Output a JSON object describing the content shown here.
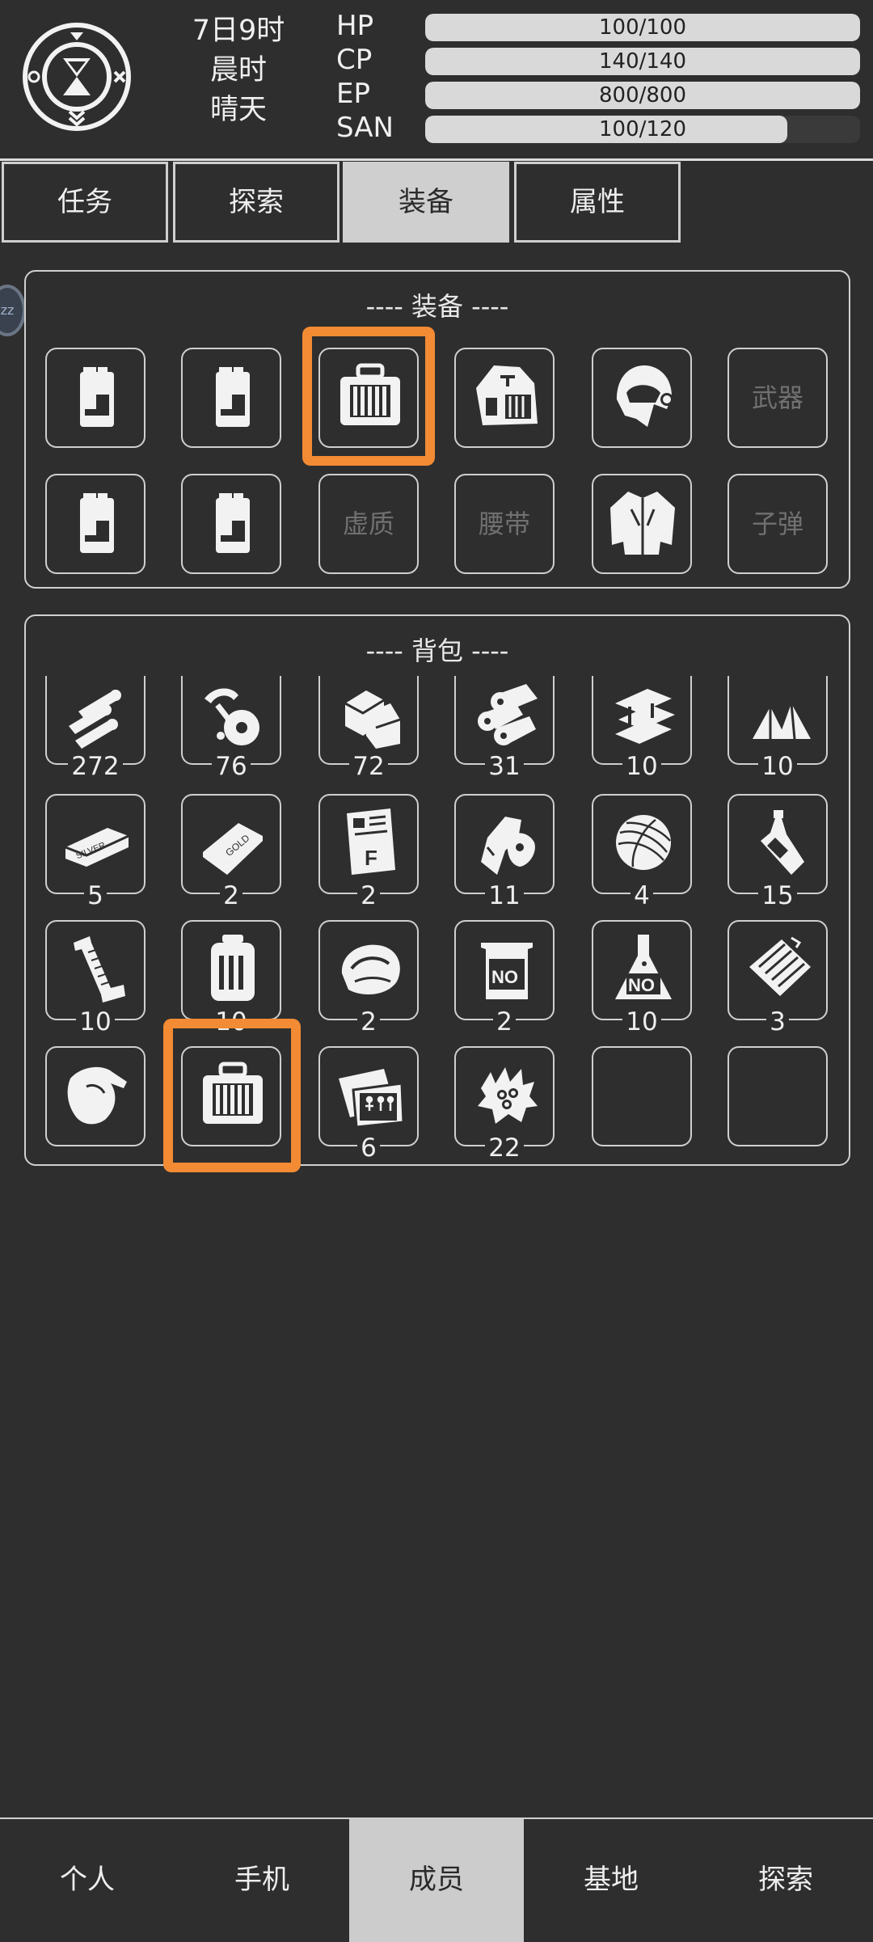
{
  "header": {
    "date": "7日9时",
    "period": "晨时",
    "weather": "晴天",
    "stats": [
      {
        "label": "HP",
        "value": "100/100",
        "fraction": 1.0
      },
      {
        "label": "CP",
        "value": "140/140",
        "fraction": 1.0
      },
      {
        "label": "EP",
        "value": "800/800",
        "fraction": 1.0
      },
      {
        "label": "SAN",
        "value": "100/120",
        "fraction": 0.833
      }
    ]
  },
  "tabs": [
    "任务",
    "探索",
    "装备",
    "属性"
  ],
  "active_tab": "装备",
  "sleep_badge": "zz",
  "equipment": {
    "title": "---- 装备 ----",
    "slots": [
      {
        "icon": "battery-icon"
      },
      {
        "icon": "battery-icon"
      },
      {
        "icon": "toolbox-icon",
        "highlighted": true
      },
      {
        "icon": "backpack-icon"
      },
      {
        "icon": "helmet-icon"
      },
      {
        "label": "武器"
      },
      {
        "icon": "battery-icon"
      },
      {
        "icon": "battery-icon"
      },
      {
        "label": "虚质"
      },
      {
        "label": "腰带"
      },
      {
        "icon": "jacket-icon"
      },
      {
        "label": "子弹"
      }
    ]
  },
  "backpack": {
    "title": "---- 背包 ----",
    "items": [
      {
        "icon": "bullets-icon",
        "count": "272"
      },
      {
        "icon": "mechanical-parts-icon",
        "count": "76"
      },
      {
        "icon": "scrap-metal-icon",
        "count": "72"
      },
      {
        "icon": "pipes-icon",
        "count": "31"
      },
      {
        "icon": "steel-beams-icon",
        "count": "10"
      },
      {
        "icon": "crystals-icon",
        "count": "10"
      },
      {
        "icon": "silver-bar-icon",
        "label": "SILVER",
        "count": "5"
      },
      {
        "icon": "gold-bar-icon",
        "label": "GOLD",
        "count": "2"
      },
      {
        "icon": "document-icon",
        "count": "2"
      },
      {
        "icon": "meat-icon",
        "count": "11"
      },
      {
        "icon": "yarn-ball-icon",
        "count": "4"
      },
      {
        "icon": "bottle-icon",
        "count": "15"
      },
      {
        "icon": "thread-spool-icon",
        "count": "10"
      },
      {
        "icon": "canister-icon",
        "count": "10"
      },
      {
        "icon": "bread-icon",
        "count": "2"
      },
      {
        "icon": "beaker-icon",
        "label": "NO",
        "count": "2"
      },
      {
        "icon": "flask-icon",
        "label": "NO",
        "count": "10"
      },
      {
        "icon": "cloth-bundle-icon",
        "count": "3"
      },
      {
        "icon": "glove-icon",
        "count": ""
      },
      {
        "icon": "toolbox-icon",
        "count": "",
        "highlighted": true
      },
      {
        "icon": "photo-icon",
        "count": "6"
      },
      {
        "icon": "cotton-icon",
        "count": "22"
      },
      {
        "icon": "empty-slot",
        "count": ""
      },
      {
        "icon": "empty-slot",
        "count": ""
      }
    ]
  },
  "bottom_nav": [
    "个人",
    "手机",
    "成员",
    "基地",
    "探索"
  ],
  "active_nav": "成员",
  "colors": {
    "background": "#2e2e2e",
    "highlight": "#f28b33",
    "active_tab": "#cfcfcf",
    "bar_fill": "#d9d9d9"
  }
}
